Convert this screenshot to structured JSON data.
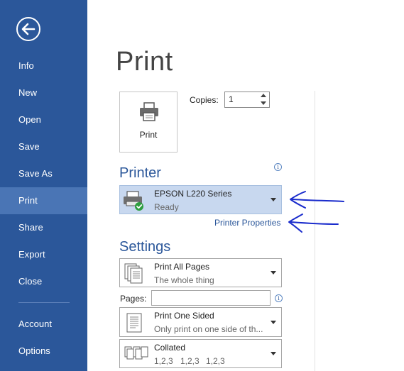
{
  "sidebar": {
    "items": [
      {
        "label": "Info"
      },
      {
        "label": "New"
      },
      {
        "label": "Open"
      },
      {
        "label": "Save"
      },
      {
        "label": "Save As"
      },
      {
        "label": "Print"
      },
      {
        "label": "Share"
      },
      {
        "label": "Export"
      },
      {
        "label": "Close"
      },
      {
        "label": "Account"
      },
      {
        "label": "Options"
      }
    ],
    "active": "Print",
    "background": "#2b579a",
    "active_background": "#4a75b5"
  },
  "main": {
    "title": "Print",
    "print_button_label": "Print",
    "copies_label": "Copies:",
    "copies_value": "1",
    "printer_section_title": "Printer",
    "printer": {
      "name": "EPSON L220 Series",
      "status": "Ready"
    },
    "printer_properties_label": "Printer Properties",
    "settings_section_title": "Settings",
    "settings": {
      "print_range": {
        "main": "Print All Pages",
        "sub": "The whole thing"
      },
      "pages_label": "Pages:",
      "pages_value": "",
      "sides": {
        "main": "Print One Sided",
        "sub": "Only print on one side of th..."
      },
      "collation": {
        "main": "Collated",
        "sub": [
          "1,2,3",
          "1,2,3",
          "1,2,3"
        ]
      }
    },
    "accent_color": "#2b579a"
  }
}
